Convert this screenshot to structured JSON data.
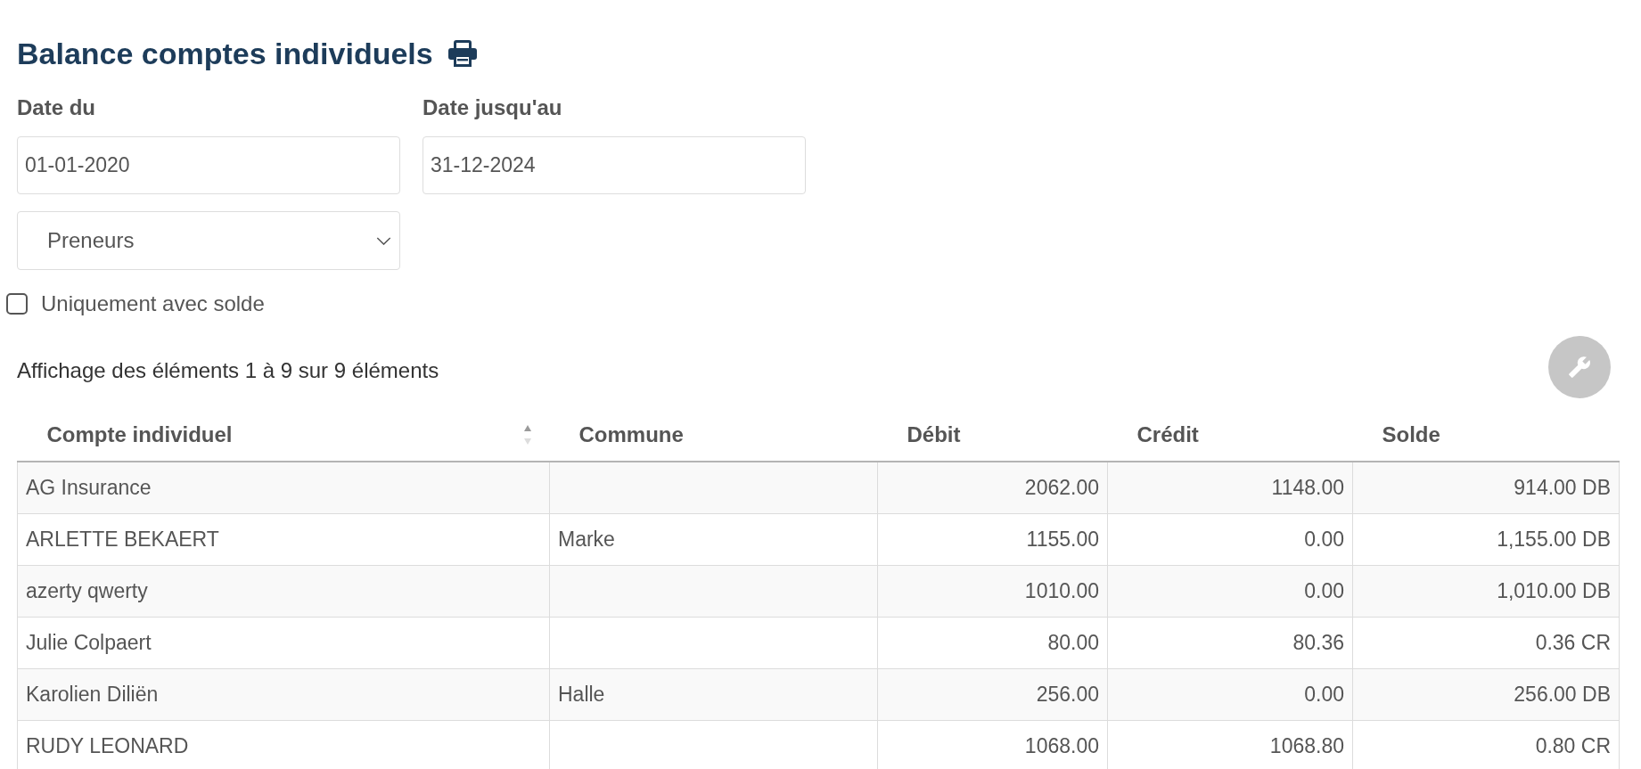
{
  "page": {
    "title": "Balance comptes individuels"
  },
  "filters": {
    "date_from": {
      "label": "Date du",
      "value": "01-01-2020"
    },
    "date_to": {
      "label": "Date jusqu'au",
      "value": "31-12-2024"
    },
    "account_type": {
      "value": "Preneurs"
    },
    "only_with_balance": {
      "label": "Uniquement avec solde",
      "checked": false
    }
  },
  "table_info": "Affichage des éléments 1 à 9 sur 9 éléments",
  "table": {
    "columns": [
      {
        "label": "Compte individuel",
        "kind": "text",
        "sorted_ascending": true
      },
      {
        "label": "Commune",
        "kind": "text"
      },
      {
        "label": "Débit",
        "kind": "amount"
      },
      {
        "label": "Crédit",
        "kind": "amount"
      },
      {
        "label": "Solde",
        "kind": "amount"
      }
    ],
    "rows": [
      {
        "compte_individuel": "AG Insurance",
        "debit": "2062.00",
        "credit": "1148.00",
        "solde": "914.00 DB"
      },
      {
        "compte_individuel": "ARLETTE BEKAERT",
        "commune": "Marke",
        "debit": "1155.00",
        "credit": "0.00",
        "solde": "1,155.00 DB"
      },
      {
        "compte_individuel": "azerty qwerty",
        "debit": "1010.00",
        "credit": "0.00",
        "solde": "1,010.00 DB"
      },
      {
        "compte_individuel": "Julie Colpaert",
        "debit": "80.00",
        "credit": "80.36",
        "solde": "0.36 CR"
      },
      {
        "compte_individuel": "Karolien Diliën",
        "commune": "Halle",
        "debit": "256.00",
        "credit": "0.00",
        "solde": "256.00 DB"
      },
      {
        "compte_individuel": "RUDY LEONARD",
        "debit": "1068.00",
        "credit": "1068.80",
        "solde": "0.80 CR"
      }
    ]
  }
}
